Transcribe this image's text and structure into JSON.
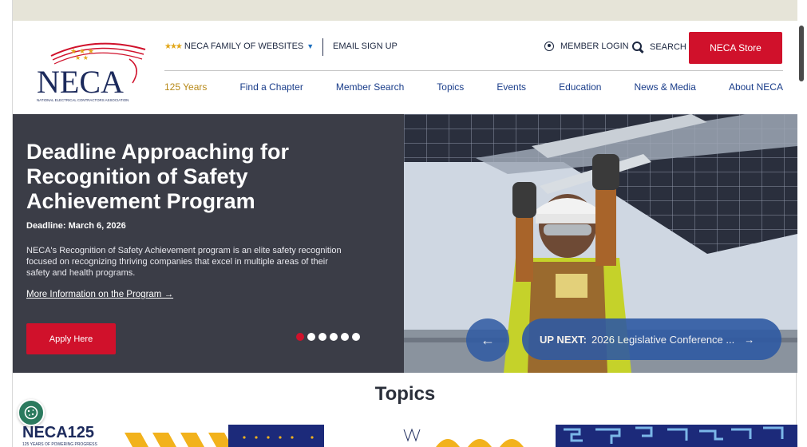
{
  "utility": {
    "family_label": "NECA FAMILY OF WEBSITES",
    "email_label": "EMAIL SIGN UP",
    "login_label": "MEMBER LOGIN",
    "search_label": "SEARCH",
    "store_label": "NECA Store"
  },
  "logo": {
    "text": "NECA",
    "tagline": "NATIONAL ELECTRICAL CONTRACTORS ASSOCIATION"
  },
  "nav": {
    "items": [
      {
        "label": "125 Years"
      },
      {
        "label": "Find a Chapter"
      },
      {
        "label": "Member Search"
      },
      {
        "label": "Topics"
      },
      {
        "label": "Events"
      },
      {
        "label": "Education"
      },
      {
        "label": "News & Media"
      },
      {
        "label": "About NECA"
      }
    ]
  },
  "hero": {
    "title": "Deadline Approaching for Recognition of Safety Achievement Program",
    "deadline": "Deadline: March 6, 2026",
    "description": "NECA's Recognition of Safety Achievement program is an elite safety recognition focused on recognizing thriving companies that excel in multiple areas of their safety and health programs.",
    "link_label": "More Information on the Program →",
    "apply_label": "Apply Here",
    "slide_count": 6,
    "active_slide": 1
  },
  "carousel": {
    "prev_arrow": "←",
    "next_prefix": "UP NEXT:",
    "next_title": "2026 Legislative Conference ...",
    "next_arrow": "→"
  },
  "sections": {
    "topics_title": "Topics"
  },
  "banner": {
    "text": "NECA125",
    "subtext": "125 YEARS OF POWERING PROGRESS"
  },
  "colors": {
    "brand_red": "#d0112b",
    "brand_navy": "#1c2a5c",
    "nav_blue": "#1a3d8a",
    "gold": "#b88a1a",
    "hero_dark": "#3b3d47",
    "pill_blue": "#2f5aa3"
  }
}
